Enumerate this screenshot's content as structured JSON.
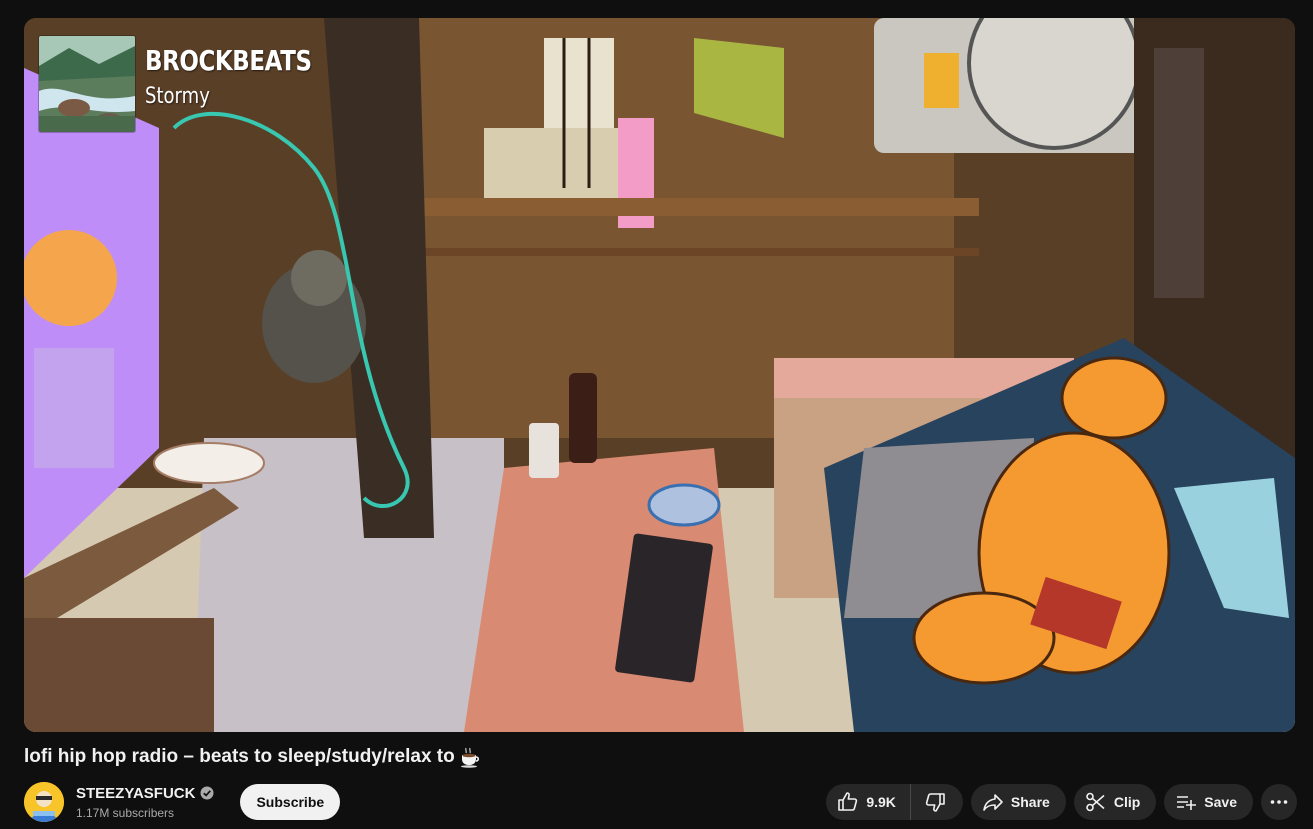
{
  "player": {
    "overlay_artist": "BROCKBEATS",
    "overlay_track": "Stormy",
    "album_art_icon": "river-landscape-art",
    "scene_icon": "lofi-room-illustration"
  },
  "video": {
    "title": "lofi hip hop radio – beats to sleep/study/relax to",
    "title_emoji_icon": "coffee-cup-icon"
  },
  "channel": {
    "name": "STEEZYASFUCK",
    "subscribers": "1.17M subscribers",
    "verified_icon": "verified-check-icon",
    "avatar_icon": "channel-avatar"
  },
  "actions": {
    "subscribe_label": "Subscribe",
    "like_count": "9.9K",
    "share_label": "Share",
    "clip_label": "Clip",
    "save_label": "Save"
  },
  "colors": {
    "background": "#0f0f0f",
    "pill": "#272727",
    "text": "#f1f1f1",
    "secondary_text": "#aaaaaa",
    "subscribe_bg": "#f1f1f1"
  }
}
